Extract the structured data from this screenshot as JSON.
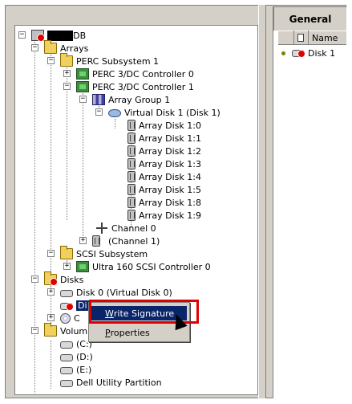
{
  "right_panel": {
    "tab": "General",
    "column_name": "Name",
    "row_label": "Disk 1"
  },
  "tree": {
    "root_suffix": "DB",
    "arrays": "Arrays",
    "perc_subsystem": "PERC Subsystem 1",
    "perc_ctrl0": "PERC 3/DC Controller 0",
    "perc_ctrl1": "PERC 3/DC Controller 1",
    "array_group": "Array Group 1",
    "virtual_disk": "Virtual Disk 1 (Disk 1)",
    "array_disks": [
      "Array Disk 1:0",
      "Array Disk 1:1",
      "Array Disk 1:2",
      "Array Disk 1:3",
      "Array Disk 1:4",
      "Array Disk 1:5",
      "Array Disk 1:8",
      "Array Disk 1:9"
    ],
    "channel0": "Channel 0",
    "channel1": "(Channel 1)",
    "scsi_subsystem": "SCSI Subsystem",
    "scsi_ctrl": "Ultra 160 SCSI Controller 0",
    "disks": "Disks",
    "disk0": "Disk 0 (Virtual Disk 0)",
    "disk1_partial": "Di",
    "cd_partial": "C",
    "volumes_partial": "Volum",
    "vol_c": "(C:)",
    "vol_d": "(D:)",
    "vol_e": "(E:)",
    "dell_partition": "Dell Utility Partition"
  },
  "context_menu": {
    "write_signature_first": "W",
    "write_signature_rest": "rite Signature",
    "properties_first": "P",
    "properties_rest": "roperties"
  }
}
